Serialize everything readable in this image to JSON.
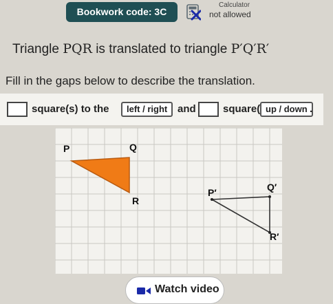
{
  "header": {
    "bookwork_code": "Bookwork code: 3C",
    "calculator_title": "Calculator",
    "calculator_status": "not allowed"
  },
  "question": {
    "prefix": "Triangle",
    "original": "PQR",
    "middle": "is translated to triangle",
    "image": "P′Q′R′"
  },
  "instruction": "Fill in the gaps below to describe the translation.",
  "answer": {
    "text1": "square(s) to the",
    "select1": "left / right",
    "text2": "and",
    "text3": "square(s)",
    "select2": "up / down",
    "end": "."
  },
  "grid": {
    "labels": {
      "P": "P",
      "Q": "Q",
      "R": "R",
      "P_prime": "P′",
      "Q_prime": "Q′",
      "R_prime": "R′"
    },
    "triangle_fill": "#f07b16",
    "image_stroke": "#333333"
  },
  "watch_video": {
    "label": "Watch video"
  },
  "colors": {
    "badge": "#1f4f54",
    "calculator_cross": "#1a2aa8"
  }
}
